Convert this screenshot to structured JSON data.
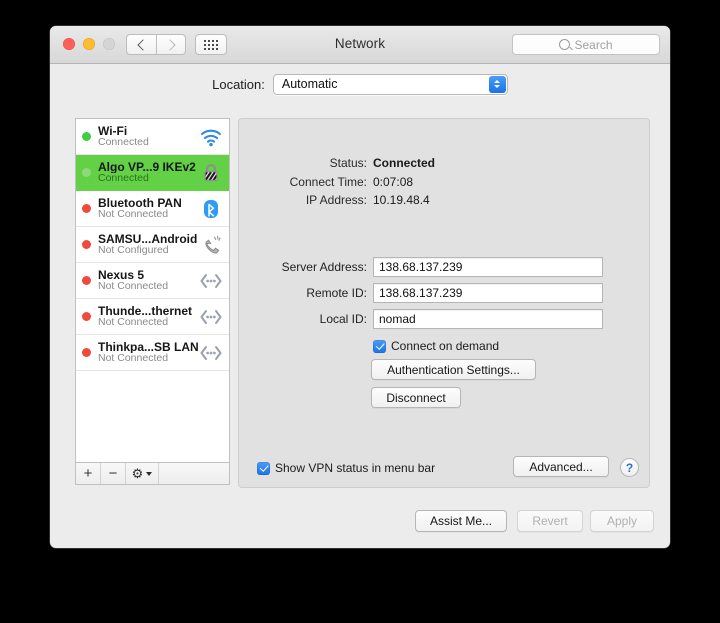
{
  "window": {
    "title": "Network",
    "traffic_lights": [
      "close",
      "minimize",
      "zoom"
    ],
    "nav_back_icon": "chevron-left-icon",
    "nav_forward_icon": "chevron-right-icon",
    "grid_icon": "show-all-grid-icon"
  },
  "search": {
    "placeholder": "Search",
    "value": "",
    "icon": "search-icon"
  },
  "location": {
    "label": "Location:",
    "value": "Automatic",
    "options": [
      "Automatic"
    ]
  },
  "services": [
    {
      "name": "Wi-Fi",
      "status": "Connected",
      "dot": "#3fce3f",
      "icon": "wifi-icon"
    },
    {
      "name": "Algo VP...9 IKEv2",
      "status": "Connected",
      "dot": "#8fd97a",
      "icon": "vpn-lock-icon",
      "selected": true
    },
    {
      "name": "Bluetooth PAN",
      "status": "Not Connected",
      "dot": "#f04a3c",
      "icon": "bluetooth-icon"
    },
    {
      "name": "SAMSU...Android",
      "status": "Not Configured",
      "dot": "#f04a3c",
      "icon": "phone-modem-icon"
    },
    {
      "name": "Nexus 5",
      "status": "Not Connected",
      "dot": "#f04a3c",
      "icon": "ethernet-icon"
    },
    {
      "name": "Thunde...thernet",
      "status": "Not Connected",
      "dot": "#f04a3c",
      "icon": "ethernet-icon"
    },
    {
      "name": "Thinkpa...SB LAN",
      "status": "Not Connected",
      "dot": "#f04a3c",
      "icon": "ethernet-icon"
    }
  ],
  "list_toolbar": {
    "add_label": "+",
    "remove_label": "−",
    "gear_label": "⚙",
    "add_icon": "plus-icon",
    "remove_icon": "minus-icon",
    "gear_icon": "gear-icon"
  },
  "detail": {
    "status_label": "Status:",
    "status_value": "Connected",
    "connect_time_label": "Connect Time:",
    "connect_time_value": "0:07:08",
    "ip_label": "IP Address:",
    "ip_value": "10.19.48.4",
    "server_label": "Server Address:",
    "server_value": "138.68.137.239",
    "remote_label": "Remote ID:",
    "remote_value": "138.68.137.239",
    "local_label": "Local ID:",
    "local_value": "nomad",
    "connect_on_demand_label": "Connect on demand",
    "connect_on_demand_checked": true,
    "auth_settings_label": "Authentication Settings...",
    "disconnect_label": "Disconnect",
    "show_vpn_status_label": "Show VPN status in menu bar",
    "show_vpn_status_checked": true,
    "advanced_label": "Advanced...",
    "help_label": "?"
  },
  "footer": {
    "assist_label": "Assist Me...",
    "revert_label": "Revert",
    "apply_label": "Apply",
    "revert_disabled": true,
    "apply_disabled": true
  },
  "colors": {
    "selection_green": "#62d146",
    "accent_blue": "#1b74e9",
    "window_bg": "#ececec",
    "panel_bg": "#e1e1e1"
  }
}
